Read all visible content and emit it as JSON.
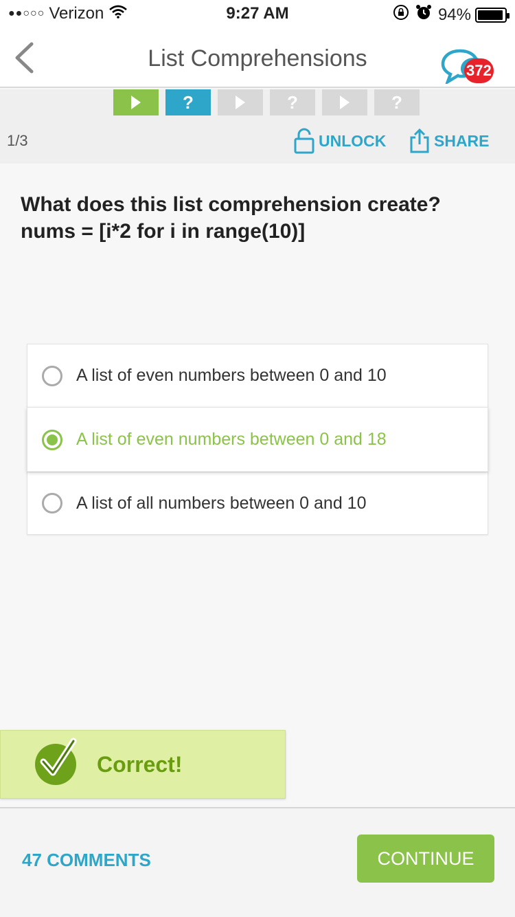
{
  "status_bar": {
    "signal": "●●○○○",
    "carrier": "Verizon",
    "time": "9:27 AM",
    "battery_percent": "94%",
    "battery_level": 0.94
  },
  "nav": {
    "title": "List Comprehensions",
    "badge_count": "372"
  },
  "lesson": {
    "steps": [
      {
        "type": "play",
        "state": "done"
      },
      {
        "type": "quiz",
        "state": "current",
        "label": "?"
      },
      {
        "type": "play",
        "state": "locked"
      },
      {
        "type": "quiz",
        "state": "locked",
        "label": "?"
      },
      {
        "type": "play",
        "state": "locked"
      },
      {
        "type": "quiz",
        "state": "locked",
        "label": "?"
      }
    ],
    "progress": "1/3",
    "unlock_label": "UNLOCK",
    "share_label": "SHARE"
  },
  "question": {
    "line1": "What does this list comprehension create?",
    "line2": "nums = [i*2 for i in range(10)]"
  },
  "options": [
    {
      "text": "A list of even numbers between 0 and 10",
      "selected": false
    },
    {
      "text": "A list of even numbers between 0 and 18",
      "selected": true
    },
    {
      "text": "A list of all numbers between 0 and 10",
      "selected": false
    }
  ],
  "feedback": {
    "text": "Correct!"
  },
  "footer": {
    "comments_label": "47 COMMENTS",
    "continue_label": "CONTINUE"
  },
  "colors": {
    "accent_green": "#8bc34a",
    "accent_blue": "#2ea6c9",
    "badge_red": "#e8222b"
  }
}
